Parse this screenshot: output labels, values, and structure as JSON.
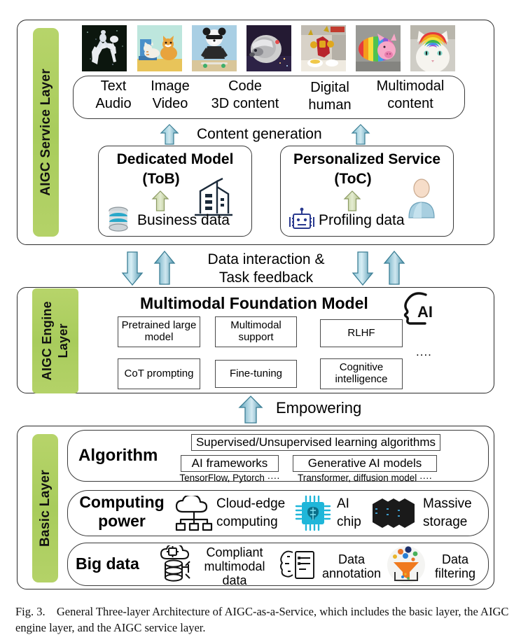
{
  "figure": {
    "caption_label": "Fig. 3.",
    "caption_text": "General Three-layer Architecture of AIGC-as-a-Service, which includes the basic layer, the AIGC engine layer, and the AIGC service layer.",
    "accent_green": "#b0cf63",
    "arrow_blue": "#4a94ad",
    "arrow_green": "#c3d49a",
    "outline": "#2b2b2b"
  },
  "service_layer": {
    "tab_label": "AIGC Service Layer",
    "thumbnails": [
      {
        "name": "astronaut-riding-horse",
        "alt": "astronaut riding a horse"
      },
      {
        "name": "cat-and-corgi",
        "alt": "cat and corgi painting"
      },
      {
        "name": "panda-skateboard",
        "alt": "panda on a skateboard"
      },
      {
        "name": "raccoon-astronaut",
        "alt": "raccoon in space helmet"
      },
      {
        "name": "iron-man-cooking",
        "alt": "iron man cooking"
      },
      {
        "name": "rainbow-pig",
        "alt": "rainbow striped pig"
      },
      {
        "name": "rainbow-hair-cat",
        "alt": "cat with rainbow hair"
      }
    ],
    "content_types": [
      {
        "top": "Text",
        "bottom": "Audio"
      },
      {
        "top": "Image",
        "bottom": "Video"
      },
      {
        "top": "Code",
        "bottom": "3D content"
      },
      {
        "top": "Digital",
        "bottom": "human"
      },
      {
        "top": "Multimodal",
        "bottom": "content"
      }
    ],
    "content_generation_label": "Content generation",
    "dedicated_model": {
      "title_line1": "Dedicated Model",
      "title_line2": "(ToB)",
      "data_label": "Business data",
      "left_icon": "database-icon",
      "right_icon": "office-building-icon",
      "up_arrow": "green-up-arrow-icon"
    },
    "personalized_service": {
      "title_line1": "Personalized Service",
      "title_line2": "(ToC)",
      "data_label": "Profiling data",
      "left_icon": "robot-icon",
      "right_icon": "user-avatar-icon",
      "up_arrow": "green-up-arrow-icon"
    }
  },
  "interlayer_service_engine": {
    "label_line1": "Data interaction &",
    "label_line2": "Task feedback",
    "arrows": [
      "down-arrow-icon",
      "up-arrow-icon",
      "down-arrow-icon",
      "up-arrow-icon"
    ]
  },
  "engine_layer": {
    "tab_label_line1": "AIGC Engine",
    "tab_label_line2": "Layer",
    "tab_label": "AIGC Engine Layer",
    "title": "Multimodal Foundation Model",
    "ai_icon": "ai-head-icon",
    "ai_icon_text": "AI",
    "capabilities_row1": [
      "Pretrained large model",
      "Multimodal support",
      "RLHF"
    ],
    "capabilities_row2": [
      "CoT prompting",
      "Fine-tuning",
      "Cognitive intelligence"
    ],
    "ellipsis": "...."
  },
  "interlayer_engine_basic": {
    "label": "Empowering",
    "arrow": "up-arrow-icon"
  },
  "basic_layer": {
    "tab_label": "Basic Layer",
    "algorithm": {
      "title": "Algorithm",
      "top_box": "Supervised/Unsupervised learning algorithms",
      "left_box": "AI frameworks",
      "left_sub": "TensorFlow, Pytorch ····",
      "right_box": "Generative AI models",
      "right_sub": "Transformer,  diffusion model ····"
    },
    "computing_power": {
      "title_line1": "Computing",
      "title_line2": "power",
      "items": [
        {
          "icon": "cloud-edge-icon",
          "line1": "Cloud-edge",
          "line2": "computing"
        },
        {
          "icon": "ai-chip-icon",
          "line1": "AI",
          "line2": "chip"
        },
        {
          "icon": "server-rack-icon",
          "line1": "Massive",
          "line2": "storage"
        }
      ]
    },
    "big_data": {
      "title": "Big data",
      "items": [
        {
          "icon": "cloud-database-icon",
          "line1": "Compliant",
          "line2": "multimodal",
          "line3": "data"
        },
        {
          "icon": "annotation-icon",
          "line1": "Data",
          "line2": "annotation"
        },
        {
          "icon": "funnel-filter-icon",
          "line1": "Data",
          "line2": "filtering"
        }
      ]
    }
  }
}
